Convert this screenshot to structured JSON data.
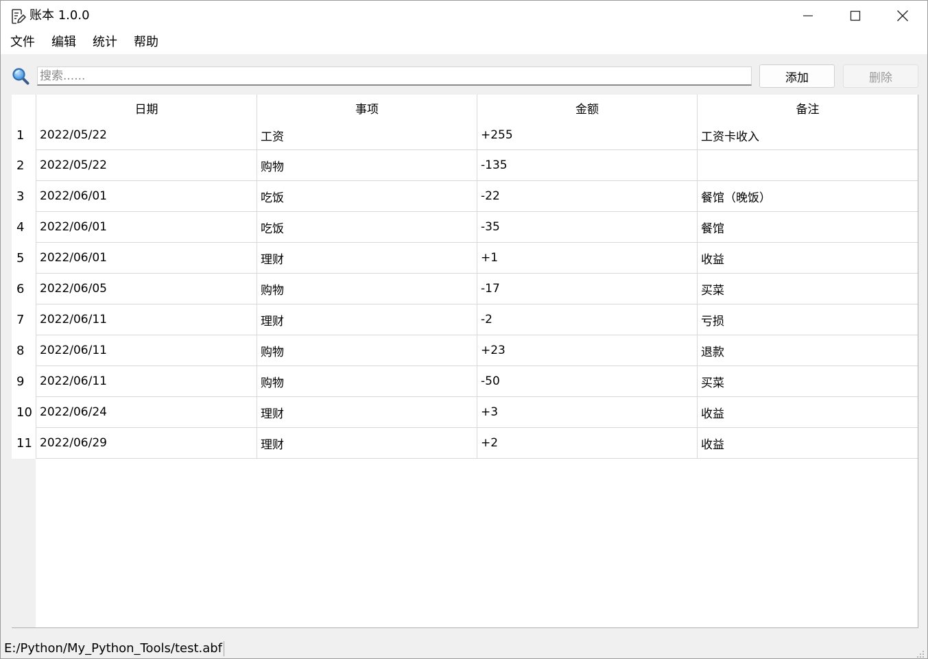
{
  "window": {
    "title": "账本 1.0.0",
    "app_icon": "notebook-edit-icon"
  },
  "menu": {
    "items": [
      "文件",
      "编辑",
      "统计",
      "帮助"
    ]
  },
  "toolbar": {
    "search_placeholder": "搜索......",
    "search_value": "",
    "add_label": "添加",
    "delete_label": "删除",
    "delete_enabled": false
  },
  "table": {
    "columns": [
      "日期",
      "事项",
      "金额",
      "备注"
    ],
    "rows": [
      {
        "num": "1",
        "date": "2022/05/22",
        "item": "工资",
        "amount": "+255",
        "note": "工资卡收入"
      },
      {
        "num": "2",
        "date": "2022/05/22",
        "item": "购物",
        "amount": "-135",
        "note": ""
      },
      {
        "num": "3",
        "date": "2022/06/01",
        "item": "吃饭",
        "amount": "-22",
        "note": "餐馆（晚饭）"
      },
      {
        "num": "4",
        "date": "2022/06/01",
        "item": "吃饭",
        "amount": "-35",
        "note": "餐馆"
      },
      {
        "num": "5",
        "date": "2022/06/01",
        "item": "理财",
        "amount": "+1",
        "note": "收益"
      },
      {
        "num": "6",
        "date": "2022/06/05",
        "item": "购物",
        "amount": "-17",
        "note": "买菜"
      },
      {
        "num": "7",
        "date": "2022/06/11",
        "item": "理财",
        "amount": "-2",
        "note": "亏损"
      },
      {
        "num": "8",
        "date": "2022/06/11",
        "item": "购物",
        "amount": "+23",
        "note": "退款"
      },
      {
        "num": "9",
        "date": "2022/06/11",
        "item": "购物",
        "amount": "-50",
        "note": "买菜"
      },
      {
        "num": "10",
        "date": "2022/06/24",
        "item": "理财",
        "amount": "+3",
        "note": "收益"
      },
      {
        "num": "11",
        "date": "2022/06/29",
        "item": "理财",
        "amount": "+2",
        "note": "收益"
      }
    ]
  },
  "statusbar": {
    "file_path": "E:/Python/My_Python_Tools/test.abf"
  }
}
